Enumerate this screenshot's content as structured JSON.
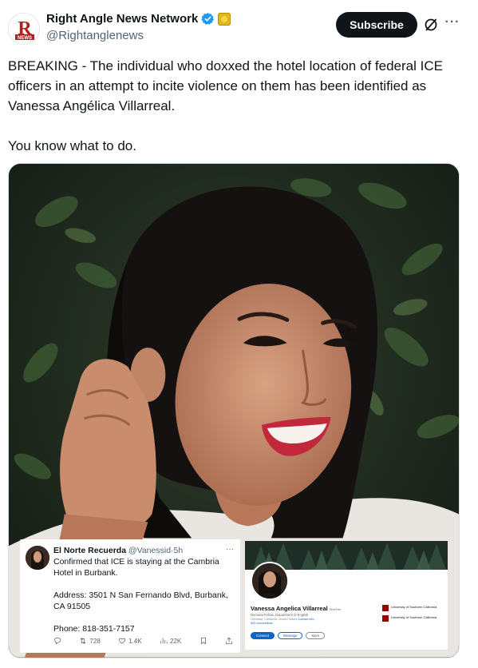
{
  "account": {
    "name": "Right Angle News Network",
    "handle": "@Rightanglenews",
    "logo_letter": "R",
    "logo_text": "NEWS",
    "subscribe_label": "Subscribe",
    "more_glyph": "···"
  },
  "post": {
    "paragraphs": [
      "BREAKING - The individual who doxxed the hotel location of federal ICE officers in an attempt to incite violence on them has been identified as Vanessa Angélica Villarreal.",
      "You know what to do."
    ]
  },
  "embedded_tweet": {
    "name": "El Norte Recuerda",
    "handle": "@Vanessid",
    "time": "5h",
    "more_glyph": "···",
    "lines": [
      "Confirmed that ICE is staying at the Cambria",
      "Hotel in Burbank.",
      "",
      "Address: 3501 N San Fernando Blvd, Burbank,",
      "CA 91505",
      "",
      "Phone: 818-351-7157"
    ],
    "retweets": "728",
    "likes": "1.4K",
    "views": "22K"
  },
  "profile_card": {
    "name": "Vanessa Angelica Villarreal",
    "pronouns": "She/Her",
    "headline": "Doctoral Fellow, Department of English",
    "location": "Glendale, California, United States",
    "contact": "Contact info",
    "connections": "500 connections",
    "buttons": [
      "Connect",
      "Message",
      "More"
    ],
    "education": [
      "University of Southern California",
      "University of Southern California"
    ]
  },
  "colors": {
    "brand_red": "#b0201e",
    "verified_blue": "#1d9bf0",
    "gold": "#e2b719",
    "linkedin_blue": "#0a66c2"
  }
}
